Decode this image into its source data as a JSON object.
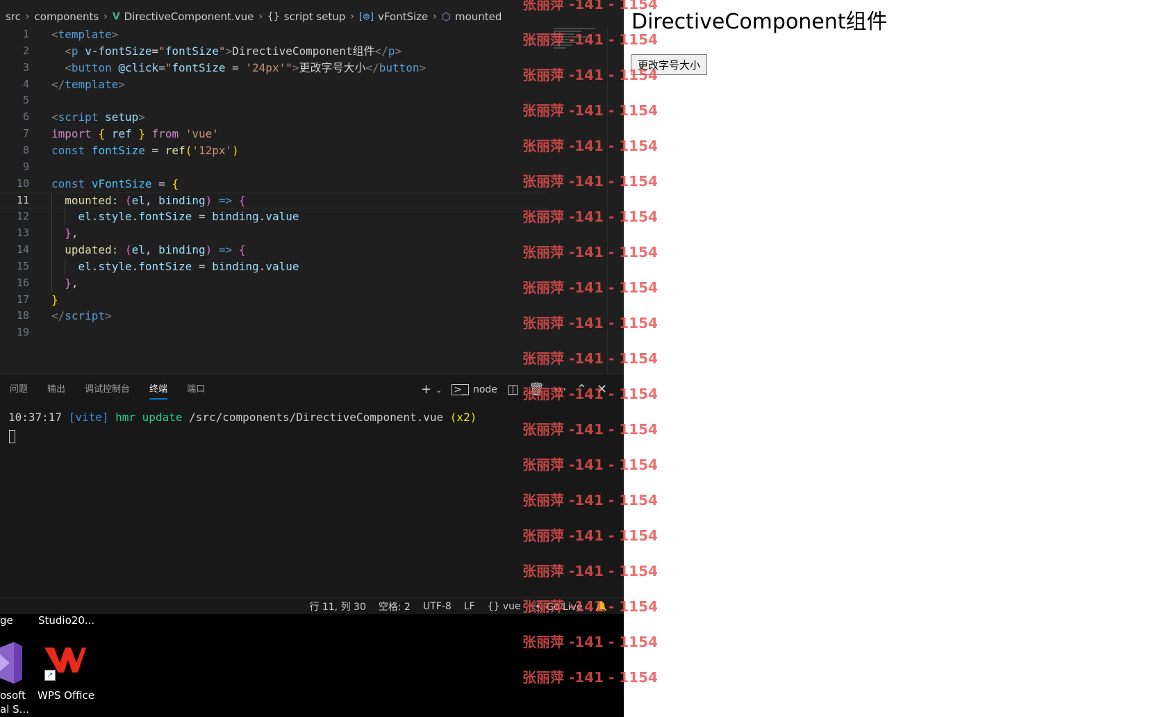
{
  "breadcrumb": [
    "src",
    "components",
    "DirectiveComponent.vue",
    "script setup",
    "vFontSize",
    "mounted"
  ],
  "editor": {
    "line_numbers": [
      "1",
      "2",
      "3",
      "4",
      "5",
      "6",
      "7",
      "8",
      "9",
      "10",
      "11",
      "12",
      "13",
      "14",
      "15",
      "16",
      "17",
      "18",
      "19"
    ],
    "active_line": "11"
  },
  "panel": {
    "tabs": [
      "问题",
      "输出",
      "调试控制台",
      "终端",
      "端口"
    ],
    "active_tab": "终端",
    "terminal_profile": "node",
    "terminal_line": {
      "time": "10:37:17",
      "tag": "[vite]",
      "event": "hmr update",
      "path": "/src/components/DirectiveComponent.vue",
      "count": "(x2)"
    }
  },
  "statusbar": {
    "position": "行 11, 列 30",
    "indent": "空格: 2",
    "encoding": "UTF-8",
    "eol": "LF",
    "language": "vue",
    "golive": "Go Live"
  },
  "desktop": {
    "label_left_top": "ge",
    "label_studio": "Studio20...",
    "label_vs_1": "osoft",
    "label_vs_2": "al S...",
    "label_wps": "WPS Office"
  },
  "browser": {
    "heading": "DirectiveComponent组件",
    "button_label": "更改字号大小"
  },
  "watermark": {
    "text": "张丽萍 -141 - 1154",
    "repeat": 20
  },
  "colors": {
    "editor_bg": "#1f1f1f",
    "panel_bg": "#181818",
    "accent": "#0078d4",
    "watermark": "#e85050"
  },
  "icons": [
    "vue-file-icon",
    "braces-icon",
    "variable-icon",
    "cube-icon",
    "plus-icon",
    "chevron-down-icon",
    "terminal-icon",
    "split-icon",
    "trash-icon",
    "more-icon",
    "chevron-up-icon",
    "close-icon",
    "braces-icon",
    "broadcast-icon",
    "bell-icon",
    "visual-studio-icon",
    "wps-office-icon"
  ]
}
